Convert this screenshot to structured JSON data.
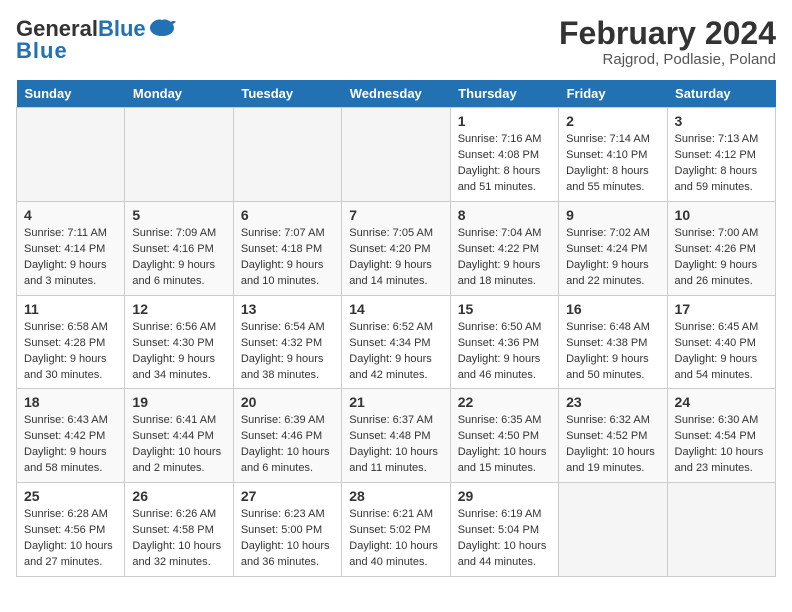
{
  "header": {
    "logo_general": "General",
    "logo_blue": "Blue",
    "title": "February 2024",
    "subtitle": "Rajgrod, Podlasie, Poland"
  },
  "days_of_week": [
    "Sunday",
    "Monday",
    "Tuesday",
    "Wednesday",
    "Thursday",
    "Friday",
    "Saturday"
  ],
  "weeks": [
    {
      "row_class": "row-odd",
      "days": [
        {
          "date": "",
          "info": "",
          "empty": true
        },
        {
          "date": "",
          "info": "",
          "empty": true
        },
        {
          "date": "",
          "info": "",
          "empty": true
        },
        {
          "date": "",
          "info": "",
          "empty": true
        },
        {
          "date": "1",
          "info": "Sunrise: 7:16 AM\nSunset: 4:08 PM\nDaylight: 8 hours\nand 51 minutes.",
          "empty": false
        },
        {
          "date": "2",
          "info": "Sunrise: 7:14 AM\nSunset: 4:10 PM\nDaylight: 8 hours\nand 55 minutes.",
          "empty": false
        },
        {
          "date": "3",
          "info": "Sunrise: 7:13 AM\nSunset: 4:12 PM\nDaylight: 8 hours\nand 59 minutes.",
          "empty": false
        }
      ]
    },
    {
      "row_class": "row-even",
      "days": [
        {
          "date": "4",
          "info": "Sunrise: 7:11 AM\nSunset: 4:14 PM\nDaylight: 9 hours\nand 3 minutes.",
          "empty": false
        },
        {
          "date": "5",
          "info": "Sunrise: 7:09 AM\nSunset: 4:16 PM\nDaylight: 9 hours\nand 6 minutes.",
          "empty": false
        },
        {
          "date": "6",
          "info": "Sunrise: 7:07 AM\nSunset: 4:18 PM\nDaylight: 9 hours\nand 10 minutes.",
          "empty": false
        },
        {
          "date": "7",
          "info": "Sunrise: 7:05 AM\nSunset: 4:20 PM\nDaylight: 9 hours\nand 14 minutes.",
          "empty": false
        },
        {
          "date": "8",
          "info": "Sunrise: 7:04 AM\nSunset: 4:22 PM\nDaylight: 9 hours\nand 18 minutes.",
          "empty": false
        },
        {
          "date": "9",
          "info": "Sunrise: 7:02 AM\nSunset: 4:24 PM\nDaylight: 9 hours\nand 22 minutes.",
          "empty": false
        },
        {
          "date": "10",
          "info": "Sunrise: 7:00 AM\nSunset: 4:26 PM\nDaylight: 9 hours\nand 26 minutes.",
          "empty": false
        }
      ]
    },
    {
      "row_class": "row-odd",
      "days": [
        {
          "date": "11",
          "info": "Sunrise: 6:58 AM\nSunset: 4:28 PM\nDaylight: 9 hours\nand 30 minutes.",
          "empty": false
        },
        {
          "date": "12",
          "info": "Sunrise: 6:56 AM\nSunset: 4:30 PM\nDaylight: 9 hours\nand 34 minutes.",
          "empty": false
        },
        {
          "date": "13",
          "info": "Sunrise: 6:54 AM\nSunset: 4:32 PM\nDaylight: 9 hours\nand 38 minutes.",
          "empty": false
        },
        {
          "date": "14",
          "info": "Sunrise: 6:52 AM\nSunset: 4:34 PM\nDaylight: 9 hours\nand 42 minutes.",
          "empty": false
        },
        {
          "date": "15",
          "info": "Sunrise: 6:50 AM\nSunset: 4:36 PM\nDaylight: 9 hours\nand 46 minutes.",
          "empty": false
        },
        {
          "date": "16",
          "info": "Sunrise: 6:48 AM\nSunset: 4:38 PM\nDaylight: 9 hours\nand 50 minutes.",
          "empty": false
        },
        {
          "date": "17",
          "info": "Sunrise: 6:45 AM\nSunset: 4:40 PM\nDaylight: 9 hours\nand 54 minutes.",
          "empty": false
        }
      ]
    },
    {
      "row_class": "row-even",
      "days": [
        {
          "date": "18",
          "info": "Sunrise: 6:43 AM\nSunset: 4:42 PM\nDaylight: 9 hours\nand 58 minutes.",
          "empty": false
        },
        {
          "date": "19",
          "info": "Sunrise: 6:41 AM\nSunset: 4:44 PM\nDaylight: 10 hours\nand 2 minutes.",
          "empty": false
        },
        {
          "date": "20",
          "info": "Sunrise: 6:39 AM\nSunset: 4:46 PM\nDaylight: 10 hours\nand 6 minutes.",
          "empty": false
        },
        {
          "date": "21",
          "info": "Sunrise: 6:37 AM\nSunset: 4:48 PM\nDaylight: 10 hours\nand 11 minutes.",
          "empty": false
        },
        {
          "date": "22",
          "info": "Sunrise: 6:35 AM\nSunset: 4:50 PM\nDaylight: 10 hours\nand 15 minutes.",
          "empty": false
        },
        {
          "date": "23",
          "info": "Sunrise: 6:32 AM\nSunset: 4:52 PM\nDaylight: 10 hours\nand 19 minutes.",
          "empty": false
        },
        {
          "date": "24",
          "info": "Sunrise: 6:30 AM\nSunset: 4:54 PM\nDaylight: 10 hours\nand 23 minutes.",
          "empty": false
        }
      ]
    },
    {
      "row_class": "row-odd",
      "days": [
        {
          "date": "25",
          "info": "Sunrise: 6:28 AM\nSunset: 4:56 PM\nDaylight: 10 hours\nand 27 minutes.",
          "empty": false
        },
        {
          "date": "26",
          "info": "Sunrise: 6:26 AM\nSunset: 4:58 PM\nDaylight: 10 hours\nand 32 minutes.",
          "empty": false
        },
        {
          "date": "27",
          "info": "Sunrise: 6:23 AM\nSunset: 5:00 PM\nDaylight: 10 hours\nand 36 minutes.",
          "empty": false
        },
        {
          "date": "28",
          "info": "Sunrise: 6:21 AM\nSunset: 5:02 PM\nDaylight: 10 hours\nand 40 minutes.",
          "empty": false
        },
        {
          "date": "29",
          "info": "Sunrise: 6:19 AM\nSunset: 5:04 PM\nDaylight: 10 hours\nand 44 minutes.",
          "empty": false
        },
        {
          "date": "",
          "info": "",
          "empty": true
        },
        {
          "date": "",
          "info": "",
          "empty": true
        }
      ]
    }
  ]
}
